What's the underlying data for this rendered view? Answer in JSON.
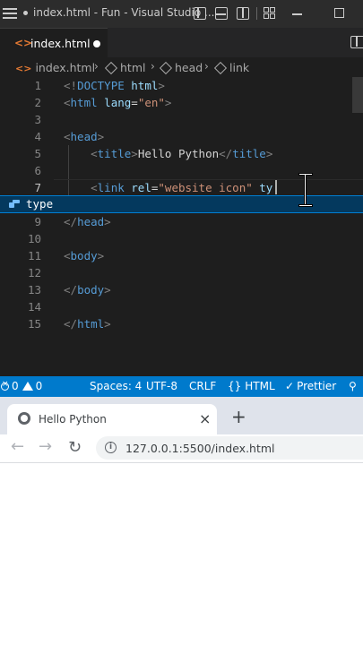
{
  "vscode": {
    "title": "index.html - Fun - Visual Studio ...",
    "tab": {
      "label": "index.html"
    },
    "breadcrumb": [
      "index.html",
      "html",
      "head",
      "link"
    ],
    "lines": [
      {
        "n": "1",
        "parts": [
          [
            "bracket",
            "<!"
          ],
          [
            "tag",
            "DOCTYPE"
          ],
          [
            "txt",
            " "
          ],
          [
            "attr",
            "html"
          ],
          [
            "bracket",
            ">"
          ]
        ]
      },
      {
        "n": "2",
        "parts": [
          [
            "bracket",
            "<"
          ],
          [
            "tag",
            "html"
          ],
          [
            "txt",
            " "
          ],
          [
            "attr",
            "lang"
          ],
          [
            "txt",
            "="
          ],
          [
            "str",
            "\"en\""
          ],
          [
            "bracket",
            ">"
          ]
        ]
      },
      {
        "n": "3",
        "parts": []
      },
      {
        "n": "4",
        "parts": [
          [
            "bracket",
            "<"
          ],
          [
            "tag",
            "head"
          ],
          [
            "bracket",
            ">"
          ]
        ]
      },
      {
        "n": "5",
        "parts": [
          [
            "txt",
            "    "
          ],
          [
            "bracket",
            "<"
          ],
          [
            "tag",
            "title"
          ],
          [
            "bracket",
            ">"
          ],
          [
            "txt",
            "Hello Python"
          ],
          [
            "bracket",
            "</"
          ],
          [
            "tag",
            "title"
          ],
          [
            "bracket",
            ">"
          ]
        ]
      },
      {
        "n": "6",
        "parts": []
      },
      {
        "n": "7",
        "parts": [
          [
            "txt",
            "    "
          ],
          [
            "bracket",
            "<"
          ],
          [
            "tag",
            "link"
          ],
          [
            "txt",
            " "
          ],
          [
            "attr",
            "rel"
          ],
          [
            "txt",
            "="
          ],
          [
            "str",
            "\"website icon\""
          ],
          [
            "txt",
            " "
          ],
          [
            "attr",
            "ty"
          ]
        ]
      },
      {
        "n": "9",
        "parts": [
          [
            "bracket",
            "</"
          ],
          [
            "tag",
            "head"
          ],
          [
            "bracket",
            ">"
          ]
        ]
      },
      {
        "n": "10",
        "parts": []
      },
      {
        "n": "11",
        "parts": [
          [
            "bracket",
            "<"
          ],
          [
            "tag",
            "body"
          ],
          [
            "bracket",
            ">"
          ]
        ]
      },
      {
        "n": "12",
        "parts": []
      },
      {
        "n": "13",
        "parts": [
          [
            "bracket",
            "</"
          ],
          [
            "tag",
            "body"
          ],
          [
            "bracket",
            ">"
          ]
        ]
      },
      {
        "n": "14",
        "parts": []
      },
      {
        "n": "15",
        "parts": [
          [
            "bracket",
            "</"
          ],
          [
            "tag",
            "html"
          ],
          [
            "bracket",
            ">"
          ]
        ]
      }
    ],
    "suggestion": {
      "label": "type"
    },
    "statusbar": {
      "errors": "0",
      "warnings": "0",
      "spaces": "Spaces: 4",
      "encoding": "UTF-8",
      "eol": "CRLF",
      "language": "HTML",
      "prettier": "Prettier"
    },
    "colors": {
      "statusbar": "#007acc",
      "editor": "#1e1e1e",
      "suggest": "#04395e"
    }
  },
  "browser": {
    "tab": {
      "title": "Hello Python",
      "close": "×"
    },
    "new_tab": "+",
    "back": "←",
    "forward": "→",
    "reload": "↻",
    "url": "127.0.0.1:5500/index.html"
  }
}
